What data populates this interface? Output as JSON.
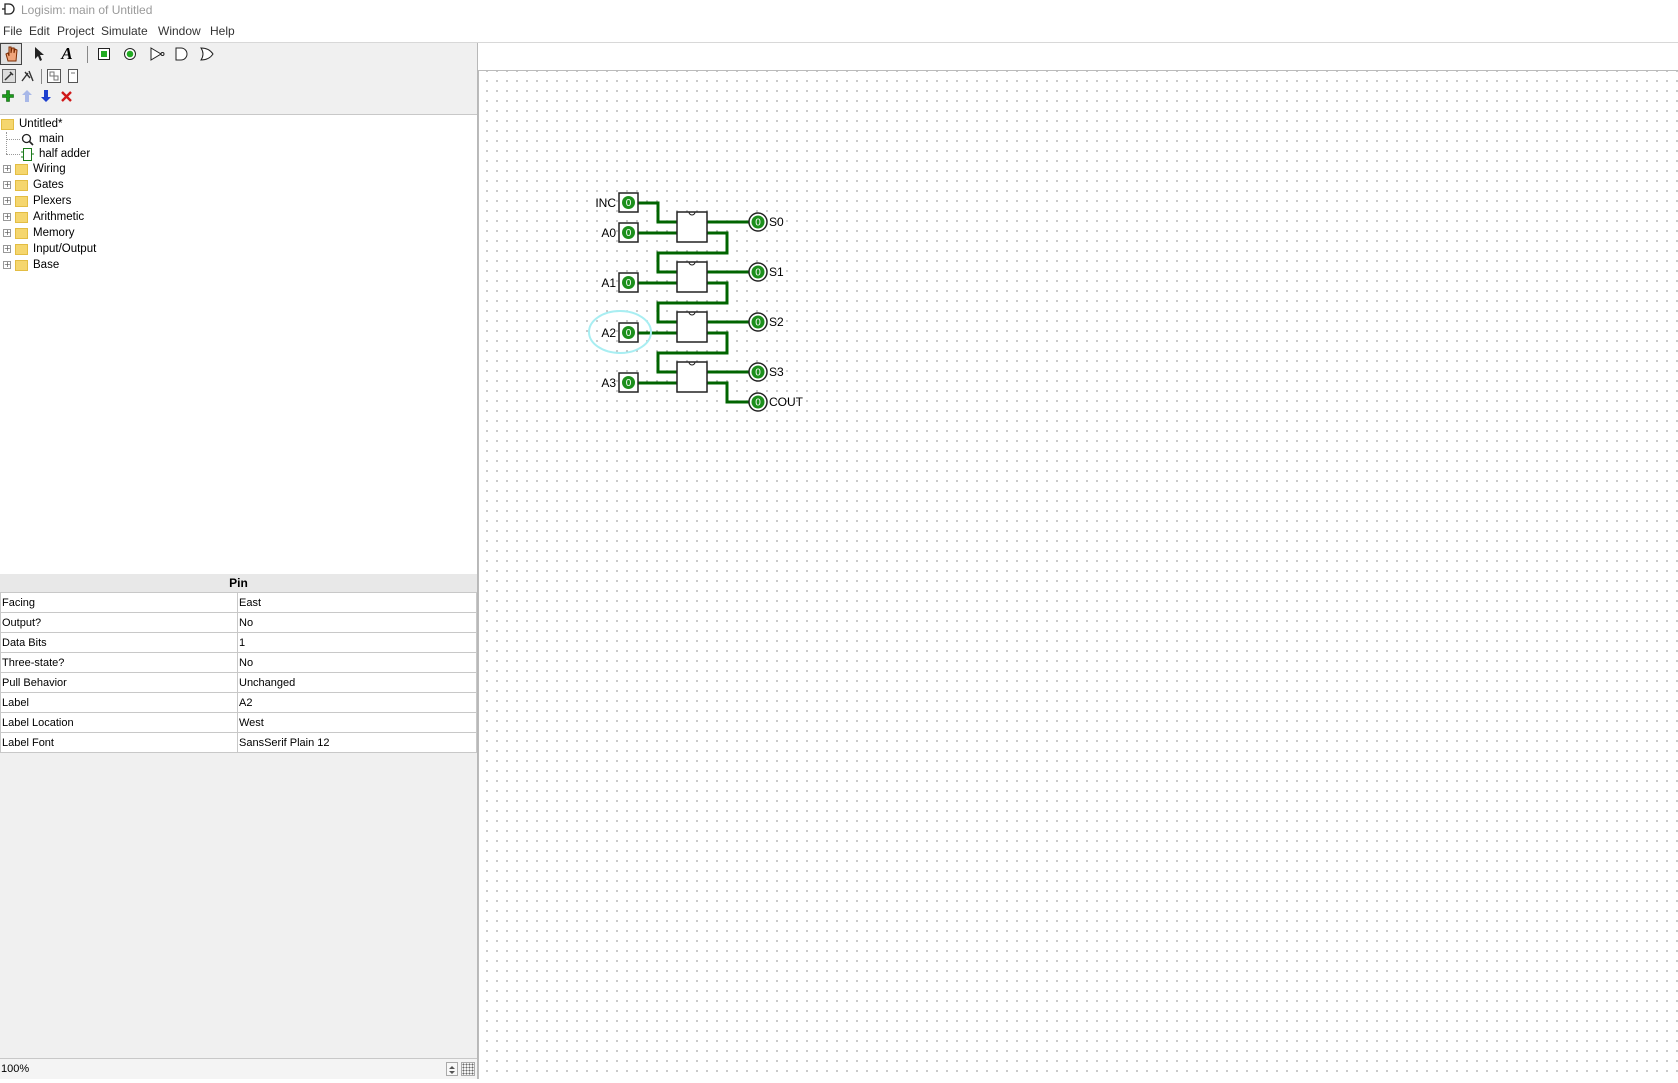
{
  "window": {
    "title": "Logisim: main of Untitled"
  },
  "menu": [
    "File",
    "Edit",
    "Project",
    "Simulate",
    "Window",
    "Help"
  ],
  "toolbar": {
    "tools": [
      "poke-tool",
      "select-tool",
      "text-tool",
      "input-pin",
      "output-pin",
      "not-gate",
      "and-gate",
      "or-gate"
    ],
    "selected": "poke-tool"
  },
  "explorer": {
    "project": "Untitled*",
    "circuits": [
      "main",
      "half adder"
    ],
    "libraries": [
      "Wiring",
      "Gates",
      "Plexers",
      "Arithmetic",
      "Memory",
      "Input/Output",
      "Base"
    ]
  },
  "attributes": {
    "title": "Pin",
    "rows": [
      {
        "key": "Facing",
        "value": "East"
      },
      {
        "key": "Output?",
        "value": "No"
      },
      {
        "key": "Data Bits",
        "value": "1"
      },
      {
        "key": "Three-state?",
        "value": "No"
      },
      {
        "key": "Pull Behavior",
        "value": "Unchanged"
      },
      {
        "key": "Label",
        "value": "A2"
      },
      {
        "key": "Label Location",
        "value": "West"
      },
      {
        "key": "Label Font",
        "value": "SansSerif Plain 12"
      }
    ]
  },
  "status": {
    "zoom": "100%"
  },
  "circuit": {
    "inputs": [
      {
        "label": "INC",
        "value": "0"
      },
      {
        "label": "A0",
        "value": "0"
      },
      {
        "label": "A1",
        "value": "0"
      },
      {
        "label": "A2",
        "value": "0"
      },
      {
        "label": "A3",
        "value": "0"
      }
    ],
    "outputs": [
      {
        "label": "S0",
        "value": "0"
      },
      {
        "label": "S1",
        "value": "0"
      },
      {
        "label": "S2",
        "value": "0"
      },
      {
        "label": "S3",
        "value": "0"
      },
      {
        "label": "COUT",
        "value": "0"
      }
    ],
    "selected_pin": "A2",
    "wire_color": "#006400",
    "highlight_color": "#a8eef2"
  }
}
